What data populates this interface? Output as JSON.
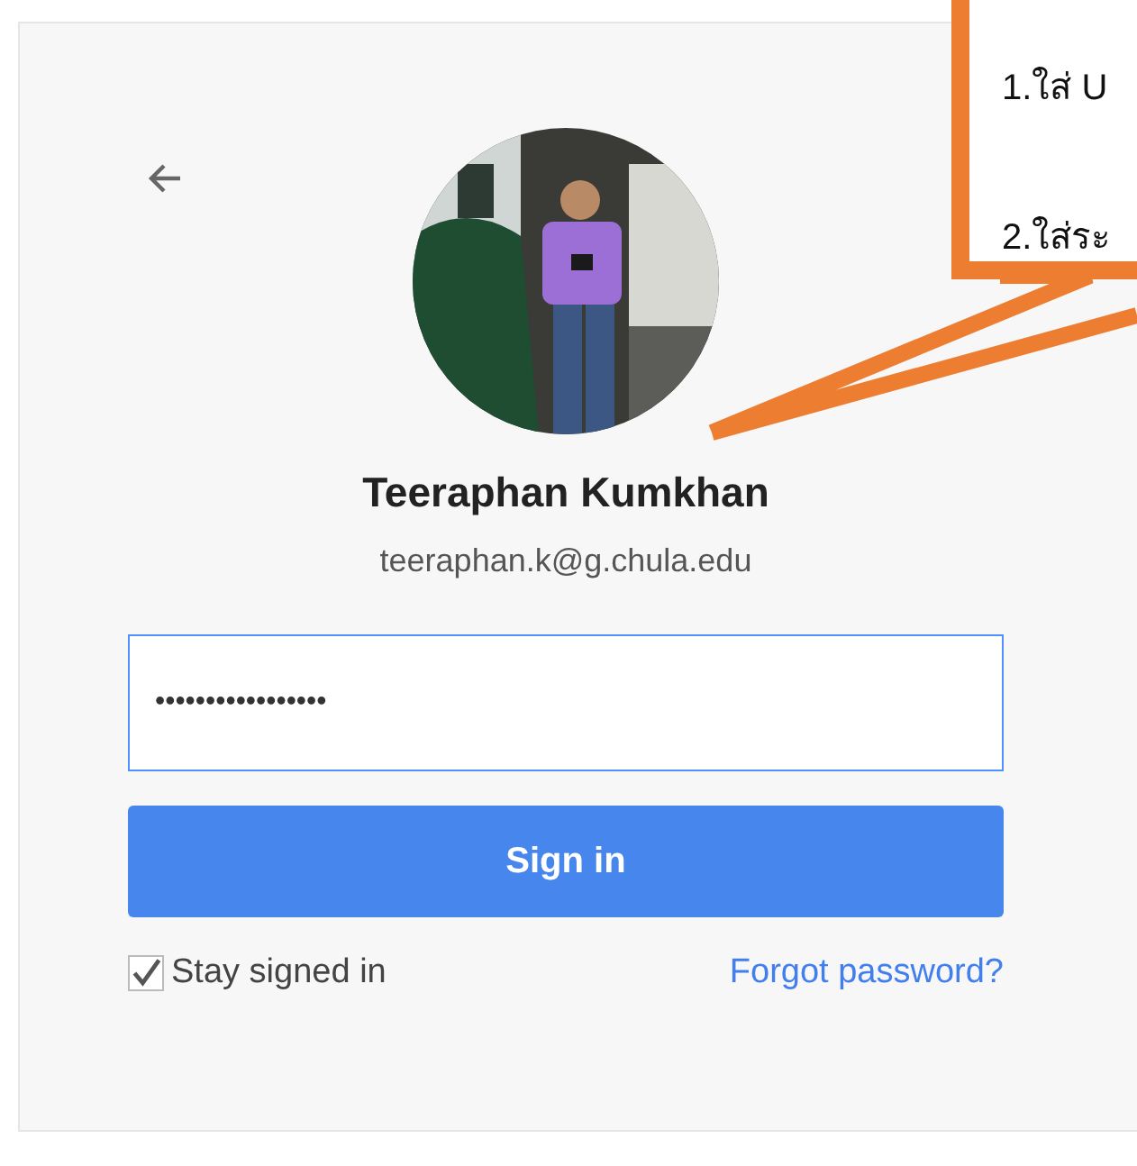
{
  "login": {
    "name": "Teeraphan Kumkhan",
    "email": "teeraphan.k@g.chula.edu",
    "password": {
      "value": "•••••••••••••••••"
    },
    "sign_in_button": "Sign in",
    "stay_signed_in": {
      "label": "Stay signed in",
      "checked": true
    },
    "forgot_link": "Forgot password?"
  },
  "callout": {
    "lines": [
      "1.ใส่ U",
      "2.ใส่ระ"
    ]
  }
}
